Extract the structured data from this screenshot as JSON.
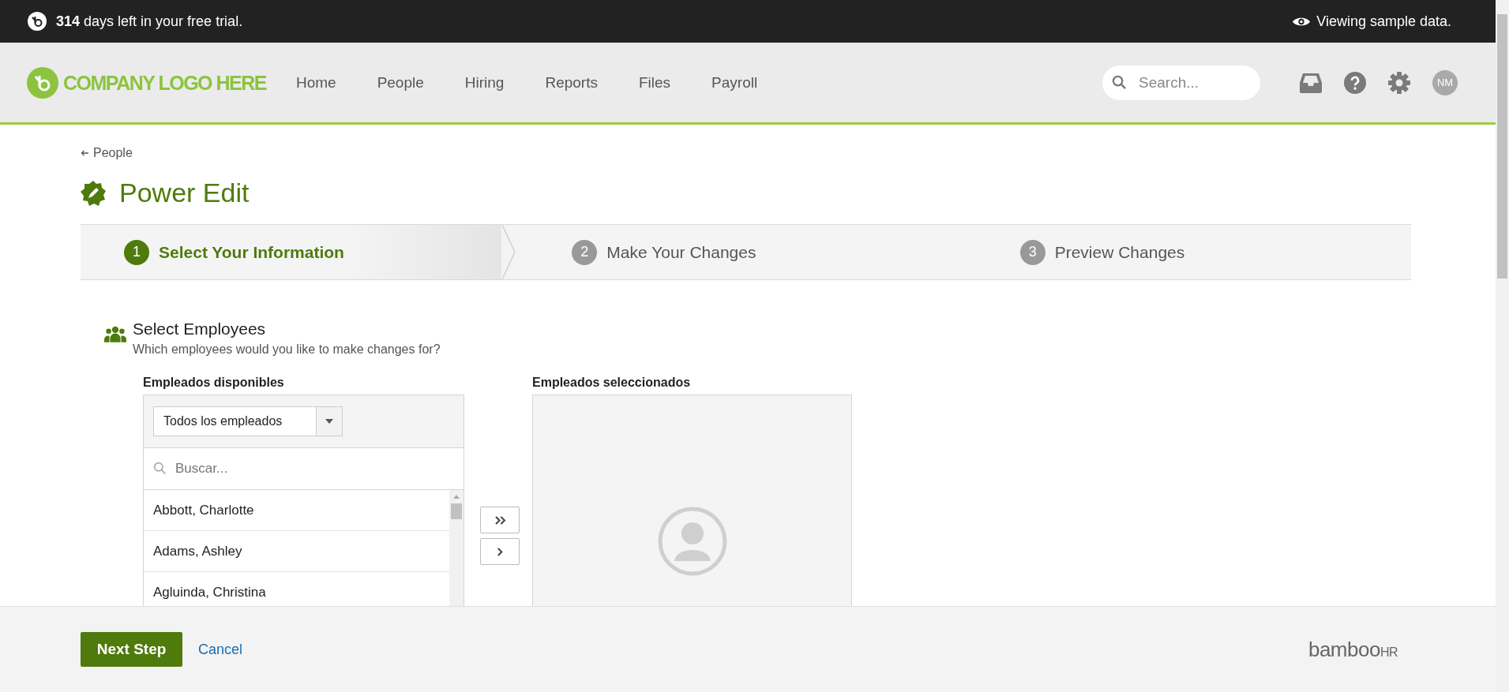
{
  "trial_banner": {
    "days": "314",
    "text": "days left in your free trial.",
    "sample_notice": "Viewing sample data."
  },
  "nav": {
    "logo_text": "COMPANY LOGO HERE",
    "items": [
      "Home",
      "People",
      "Hiring",
      "Reports",
      "Files",
      "Payroll"
    ],
    "search_placeholder": "Search...",
    "avatar_initials": "NM"
  },
  "breadcrumb": "People",
  "page_title": "Power Edit",
  "steps": [
    {
      "number": "1",
      "label": "Select Your Information",
      "selected": true
    },
    {
      "number": "2",
      "label": "Make Your Changes",
      "selected": false
    },
    {
      "number": "3",
      "label": "Preview Changes",
      "selected": false
    }
  ],
  "section": {
    "title": "Select Employees",
    "subtitle": "Which employees would you like to make changes for?"
  },
  "available": {
    "label": "Empleados disponibles",
    "filter_value": "Todos los empleados",
    "search_placeholder": "Buscar...",
    "employees": [
      "Abbott, Charlotte",
      "Adams, Ashley",
      "Agluinda, Christina"
    ]
  },
  "selected_panel": {
    "label": "Empleados seleccionados"
  },
  "footer": {
    "primary_button": "Next Step",
    "cancel_link": "Cancel",
    "brand": "bamboo",
    "brand_suffix": "HR"
  }
}
